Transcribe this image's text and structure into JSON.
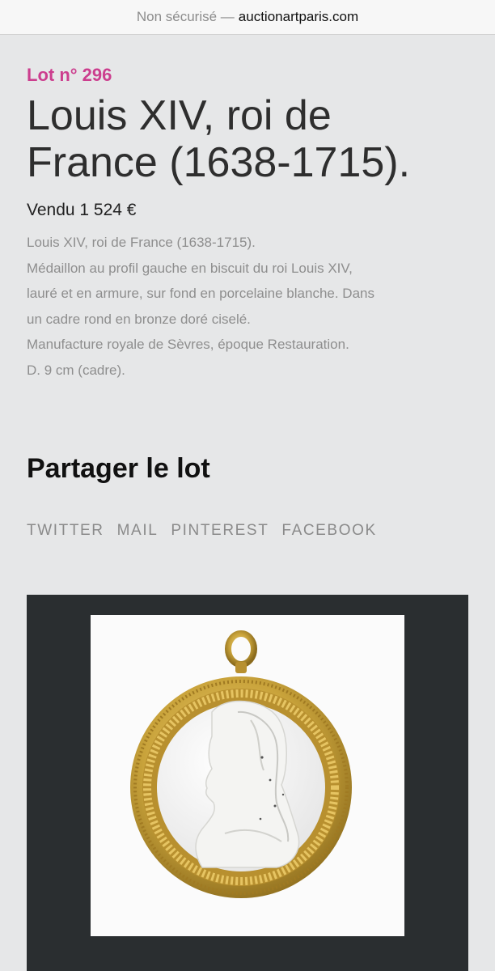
{
  "browser": {
    "security_label": "Non sécurisé —",
    "domain": "auctionartparis.com"
  },
  "lot": {
    "number_label": "Lot n° 296",
    "title_lines": [
      "Louis XIV, roi de",
      "France (1638-1715)."
    ],
    "sold_label": "Vendu 1 524 €",
    "description_lines": [
      "Louis XIV, roi de France (1638-1715).",
      "Médaillon au profil gauche en biscuit du roi Louis XIV,",
      "lauré et en armure, sur fond en porcelaine blanche. Dans",
      "un cadre rond en bronze doré ciselé.",
      "Manufacture royale de Sèvres, époque Restauration.",
      "D. 9 cm (cadre)."
    ]
  },
  "share": {
    "title": "Partager le lot",
    "links": [
      "TWITTER",
      "MAIL",
      "PINTEREST",
      "FACEBOOK"
    ]
  },
  "colors": {
    "lot_number": "#cc3e8e",
    "background": "#e6e7e8",
    "photo_frame": "#2a2e30",
    "gilt_bronze": "#c9a33b"
  }
}
